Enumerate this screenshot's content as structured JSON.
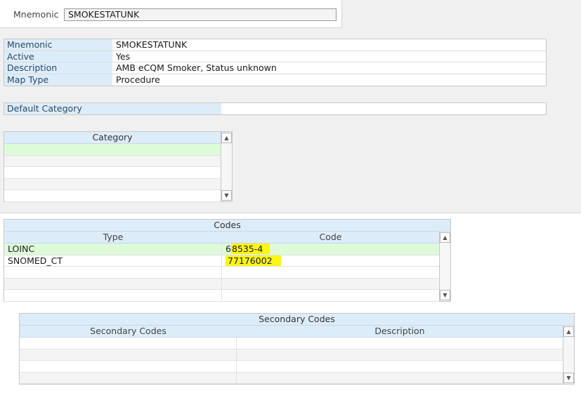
{
  "header": {
    "mnemonic_label": "Mnemonic",
    "mnemonic_value": "SMOKESTATUNK"
  },
  "details": [
    {
      "key": "Mnemonic",
      "value": "SMOKESTATUNK"
    },
    {
      "key": "Active",
      "value": "Yes"
    },
    {
      "key": "Description",
      "value": "AMB eCQM Smoker, Status unknown"
    },
    {
      "key": "Map Type",
      "value": "Procedure"
    }
  ],
  "default_category": {
    "label": "Default Category",
    "value": ""
  },
  "category_grid": {
    "title": "Category"
  },
  "codes_grid": {
    "title": "Codes",
    "columns": [
      "Type",
      "Code"
    ],
    "rows": [
      {
        "type": "LOINC",
        "code_pre": "6",
        "code_hl": "8535-4"
      },
      {
        "type": "SNOMED_CT",
        "code_pre": "",
        "code_hl": "77176002"
      }
    ]
  },
  "secondary_grid": {
    "title": "Secondary Codes",
    "columns": [
      "Secondary Codes",
      "Description"
    ]
  },
  "scroll": {
    "up_icon": "▲",
    "down_icon": "▼"
  },
  "colors": {
    "header_blue": "#ddecf9",
    "selected_row": "#ddfbd8",
    "highlight": "#faf616"
  }
}
